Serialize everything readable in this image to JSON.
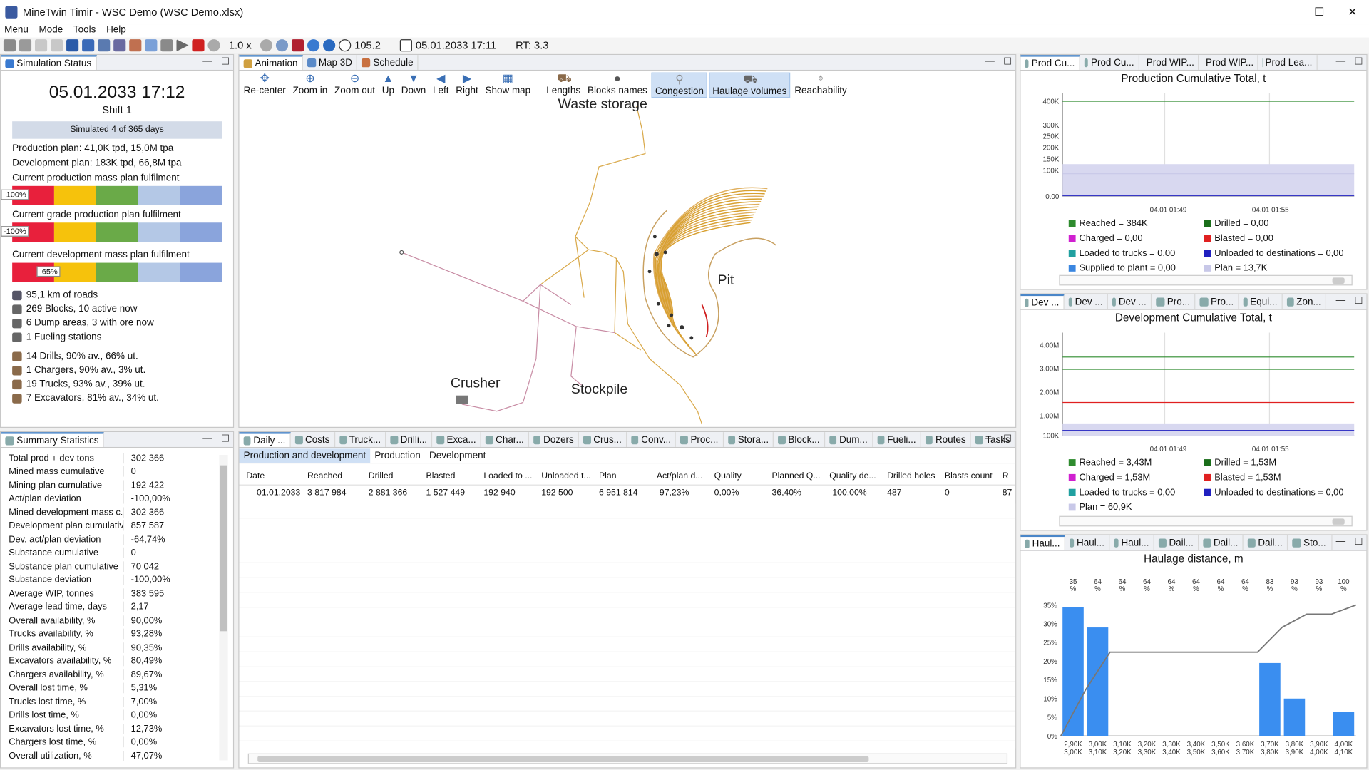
{
  "window": {
    "title": "MineTwin Timir - WSC Demo (WSC Demo.xlsx)",
    "min": "—",
    "max": "☐",
    "close": "✕"
  },
  "menu": [
    "Menu",
    "Mode",
    "Tools",
    "Help"
  ],
  "toolbar": {
    "speed": "1.0 x",
    "clock": "105.2",
    "datetime": "05.01.2033 17:11",
    "rt": "RT: 3.3"
  },
  "sim_status": {
    "tab": "Simulation Status",
    "datetime": "05.01.2033 17:12",
    "shift": "Shift 1",
    "simulated": "Simulated 4 of 365 days",
    "production_plan": "Production plan: 41,0K tpd, 15,0M tpa",
    "development_plan": "Development plan: 183K tpd, 66,8M tpa",
    "prod_mass_label": "Current production mass plan fulfilment",
    "prod_mass_badge": "-100%",
    "grade_label": "Current grade production plan fulfilment",
    "grade_badge": "-100%",
    "dev_mass_label": "Current development mass plan fulfilment",
    "dev_mass_badge": "-65%",
    "roads": "95,1 km of roads",
    "blocks": "269 Blocks, 10 active now",
    "dumps": "6 Dump areas, 3 with ore now",
    "fueling": "1 Fueling stations",
    "drills": "14 Drills, 90% av., 66% ut.",
    "chargers": "1 Chargers, 90% av., 3% ut.",
    "trucks": "19 Trucks, 93% av., 39% ut.",
    "excavators": "7 Excavators, 81% av., 34% ut."
  },
  "summary": {
    "tab": "Summary Statistics",
    "rows": [
      [
        "Total prod + dev tons",
        "302 366"
      ],
      [
        "Mined mass cumulative",
        "0"
      ],
      [
        "Mining plan cumulative",
        "192 422"
      ],
      [
        "Act/plan deviation",
        "-100,00%"
      ],
      [
        "Mined development mass c...",
        "302 366"
      ],
      [
        "Development plan cumulative",
        "857 587"
      ],
      [
        "Dev. act/plan deviation",
        "-64,74%"
      ],
      [
        "Substance cumulative",
        "0"
      ],
      [
        "Substance plan cumulative",
        "70 042"
      ],
      [
        "Substance deviation",
        "-100,00%"
      ],
      [
        "Average WIP, tonnes",
        "383 595"
      ],
      [
        "Average lead time, days",
        "2,17"
      ],
      [
        "Overall availability, %",
        "90,00%"
      ],
      [
        "Trucks availability, %",
        "93,28%"
      ],
      [
        "Drills availability, %",
        "90,35%"
      ],
      [
        "Excavators availability, %",
        "80,49%"
      ],
      [
        "Chargers availability, %",
        "89,67%"
      ],
      [
        "Overall lost time, %",
        "5,31%"
      ],
      [
        "Trucks lost time, %",
        "7,00%"
      ],
      [
        "Drills lost time, %",
        "0,00%"
      ],
      [
        "Excavators lost time, %",
        "12,73%"
      ],
      [
        "Chargers lost time, %",
        "0,00%"
      ],
      [
        "Overall utilization, %",
        "47,07%"
      ]
    ]
  },
  "center_tabs": [
    "Animation",
    "Map 3D",
    "Schedule"
  ],
  "map_tools": [
    "Re-center",
    "Zoom in",
    "Zoom out",
    "Up",
    "Down",
    "Left",
    "Right",
    "Show map",
    "Lengths",
    "Blocks names",
    "Congestion",
    "Haulage volumes",
    "Reachability"
  ],
  "map_labels": {
    "waste": "Waste storage",
    "pit": "Pit",
    "crusher": "Crusher",
    "stockpile": "Stockpile"
  },
  "bottom_tabs": [
    "Daily ...",
    "Costs",
    "Truck...",
    "Drilli...",
    "Exca...",
    "Char...",
    "Dozers",
    "Crus...",
    "Conv...",
    "Proc...",
    "Stora...",
    "Block...",
    "Dum...",
    "Fueli...",
    "Routes",
    "Tasks"
  ],
  "sub_tabs": [
    "Production and development",
    "Production",
    "Development"
  ],
  "daily_table": {
    "headers": [
      "Date",
      "Reached",
      "Drilled",
      "Blasted",
      "Loaded to ...",
      "Unloaded t...",
      "Plan",
      "Act/plan d...",
      "Quality",
      "Planned Q...",
      "Quality de...",
      "Drilled holes",
      "Blasts count",
      "R"
    ],
    "rows": [
      [
        "01.01.2033",
        "3 817 984",
        "2 881 366",
        "1 527 449",
        "192 940",
        "192 500",
        "6 951 814",
        "-97,23%",
        "0,00%",
        "36,40%",
        "-100,00%",
        "487",
        "0",
        "87"
      ]
    ]
  },
  "prod_panel": {
    "tabs": [
      "Prod Cu...",
      "Prod Cu...",
      "Prod WIP...",
      "Prod WIP...",
      "Prod Lea..."
    ],
    "title": "Production Cumulative Total, t",
    "yticks": [
      "400K",
      "300K",
      "250K",
      "200K",
      "150K",
      "100K",
      "0.00"
    ],
    "xticks": [
      "04.01 01:49",
      "04.01 01:55"
    ],
    "legend": [
      {
        "label": "Reached = 384K",
        "color": "#2e8b2e"
      },
      {
        "label": "Drilled = 0,00",
        "color": "#1a6e1a"
      },
      {
        "label": "Charged = 0,00",
        "color": "#d020d0"
      },
      {
        "label": "Blasted = 0,00",
        "color": "#e02020"
      },
      {
        "label": "Loaded to trucks = 0,00",
        "color": "#20a0a0"
      },
      {
        "label": "Unloaded to destinations = 0,00",
        "color": "#2020c0"
      },
      {
        "label": "Supplied to plant = 0,00",
        "color": "#3a86e0"
      },
      {
        "label": "Plan = 13,7K",
        "color": "#c8c8e8"
      }
    ]
  },
  "dev_panel": {
    "tabs": [
      "Dev ...",
      "Dev ...",
      "Dev ...",
      "Pro...",
      "Pro...",
      "Equi...",
      "Zon..."
    ],
    "title": "Development Cumulative Total, t",
    "yticks": [
      "4.00M",
      "3.00M",
      "2.00M",
      "1.00M",
      "100K"
    ],
    "xticks": [
      "04.01 01:49",
      "04.01 01:55"
    ],
    "legend": [
      {
        "label": "Reached = 3,43M",
        "color": "#2e8b2e"
      },
      {
        "label": "Drilled = 1,53M",
        "color": "#1a6e1a"
      },
      {
        "label": "Charged = 1,53M",
        "color": "#d020d0"
      },
      {
        "label": "Blasted = 1,53M",
        "color": "#e02020"
      },
      {
        "label": "Loaded to trucks = 0,00",
        "color": "#20a0a0"
      },
      {
        "label": "Unloaded to destinations = 0,00",
        "color": "#2020c0"
      },
      {
        "label": "Plan = 60,9K",
        "color": "#c8c8e8"
      }
    ]
  },
  "haul_panel": {
    "tabs": [
      "Haul...",
      "Haul...",
      "Haul...",
      "Dail...",
      "Dail...",
      "Dail...",
      "Sto..."
    ]
  },
  "chart_data": {
    "type": "bar",
    "title": "Haulage distance, m",
    "yticks": [
      "35%",
      "30%",
      "25%",
      "20%",
      "15%",
      "10%",
      "5%",
      "0%"
    ],
    "ylim": [
      0,
      35
    ],
    "categories": [
      "2,90K 3,00K",
      "3,00K 3,10K",
      "3,10K 3,20K",
      "3,20K 3,30K",
      "3,30K 3,40K",
      "3,40K 3,50K",
      "3,50K 3,60K",
      "3,60K 3,70K",
      "3,70K 3,80K",
      "3,80K 3,90K",
      "3,90K 4,00K",
      "4,00K 4,10K"
    ],
    "values": [
      34.5,
      29,
      0,
      0,
      0,
      0,
      0,
      0,
      19.5,
      10,
      0,
      6.5
    ],
    "cumulative_labels": [
      "35 %",
      "64 %",
      "64 %",
      "64 %",
      "64 %",
      "64 %",
      "64 %",
      "64 %",
      "83 %",
      "93 %",
      "93 %",
      "100 %"
    ],
    "cumulative": [
      35,
      64,
      64,
      64,
      64,
      64,
      64,
      64,
      83,
      93,
      93,
      100
    ],
    "bar_color": "#3a8ef0"
  }
}
